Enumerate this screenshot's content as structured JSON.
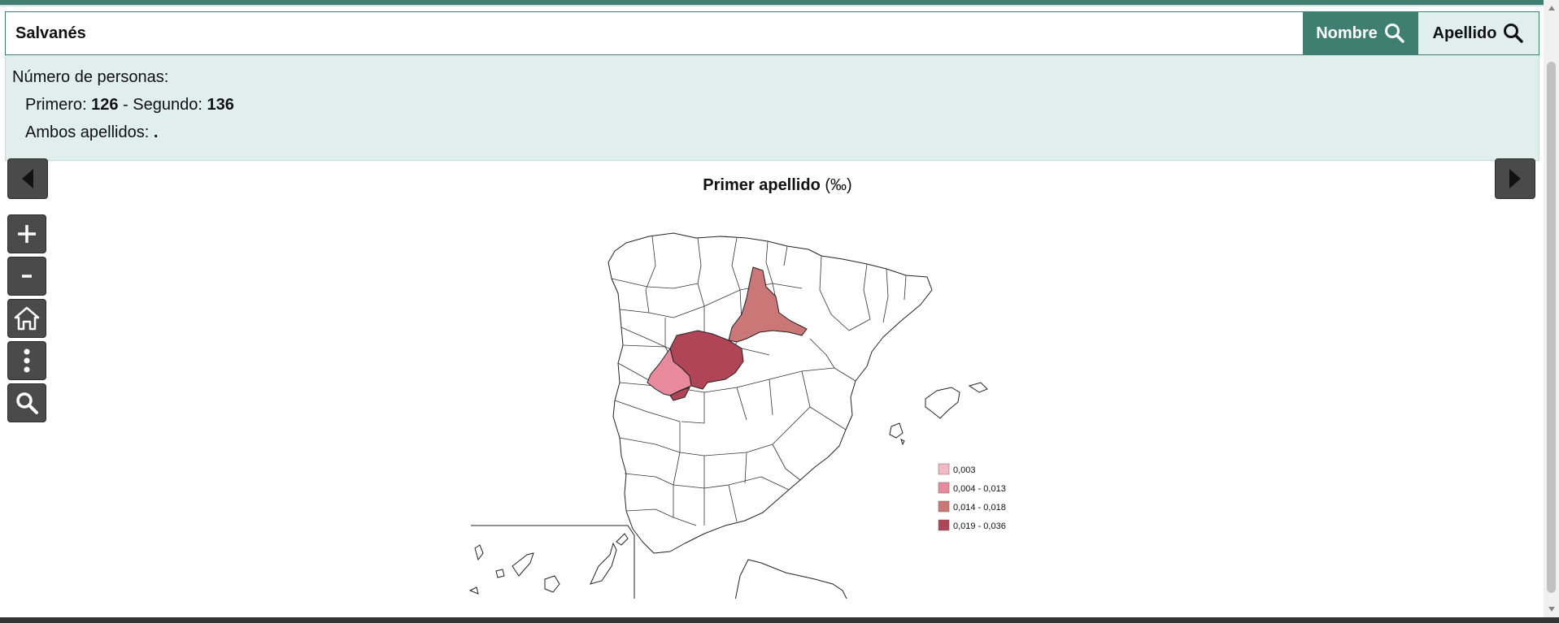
{
  "search": {
    "value": "Salvanés",
    "nombre_label": "Nombre",
    "apellido_label": "Apellido"
  },
  "info": {
    "heading": "Número de personas:",
    "primero_label": "Primero: ",
    "primero_value": "126",
    "separator": " - Segundo: ",
    "segundo_value": "136",
    "ambos_label": "Ambos apellidos: ",
    "ambos_value": "."
  },
  "map": {
    "title": "Primer apellido",
    "unit": "(‰)",
    "legend": [
      {
        "label": "0,003",
        "color": "#f5b8c6"
      },
      {
        "label": "0,004 - 0,013",
        "color": "#e98a9c"
      },
      {
        "label": "0,014 - 0,018",
        "color": "#cc7777"
      },
      {
        "label": "0,019 - 0,036",
        "color": "#b04558"
      }
    ]
  },
  "controls": {
    "prev": "prev-map",
    "next": "next-map",
    "zoom_in": "plus-icon",
    "zoom_out": "minus-icon",
    "home": "home-icon",
    "menu": "vertical-dots-icon",
    "search": "search-icon"
  }
}
